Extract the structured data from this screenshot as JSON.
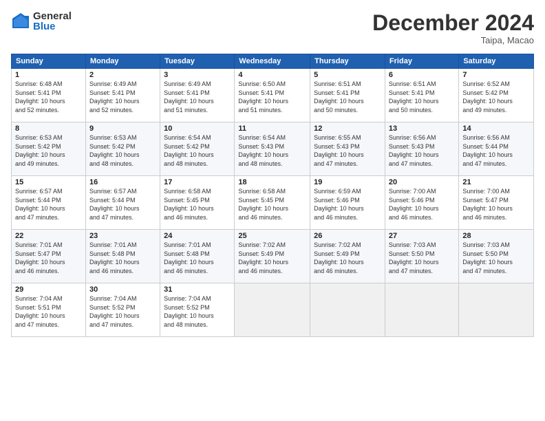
{
  "logo": {
    "general": "General",
    "blue": "Blue"
  },
  "header": {
    "title": "December 2024",
    "location": "Taipa, Macao"
  },
  "weekdays": [
    "Sunday",
    "Monday",
    "Tuesday",
    "Wednesday",
    "Thursday",
    "Friday",
    "Saturday"
  ],
  "weeks": [
    [
      {
        "day": "1",
        "info": "Sunrise: 6:48 AM\nSunset: 5:41 PM\nDaylight: 10 hours\nand 52 minutes."
      },
      {
        "day": "2",
        "info": "Sunrise: 6:49 AM\nSunset: 5:41 PM\nDaylight: 10 hours\nand 52 minutes."
      },
      {
        "day": "3",
        "info": "Sunrise: 6:49 AM\nSunset: 5:41 PM\nDaylight: 10 hours\nand 51 minutes."
      },
      {
        "day": "4",
        "info": "Sunrise: 6:50 AM\nSunset: 5:41 PM\nDaylight: 10 hours\nand 51 minutes."
      },
      {
        "day": "5",
        "info": "Sunrise: 6:51 AM\nSunset: 5:41 PM\nDaylight: 10 hours\nand 50 minutes."
      },
      {
        "day": "6",
        "info": "Sunrise: 6:51 AM\nSunset: 5:41 PM\nDaylight: 10 hours\nand 50 minutes."
      },
      {
        "day": "7",
        "info": "Sunrise: 6:52 AM\nSunset: 5:42 PM\nDaylight: 10 hours\nand 49 minutes."
      }
    ],
    [
      {
        "day": "8",
        "info": "Sunrise: 6:53 AM\nSunset: 5:42 PM\nDaylight: 10 hours\nand 49 minutes."
      },
      {
        "day": "9",
        "info": "Sunrise: 6:53 AM\nSunset: 5:42 PM\nDaylight: 10 hours\nand 48 minutes."
      },
      {
        "day": "10",
        "info": "Sunrise: 6:54 AM\nSunset: 5:42 PM\nDaylight: 10 hours\nand 48 minutes."
      },
      {
        "day": "11",
        "info": "Sunrise: 6:54 AM\nSunset: 5:43 PM\nDaylight: 10 hours\nand 48 minutes."
      },
      {
        "day": "12",
        "info": "Sunrise: 6:55 AM\nSunset: 5:43 PM\nDaylight: 10 hours\nand 47 minutes."
      },
      {
        "day": "13",
        "info": "Sunrise: 6:56 AM\nSunset: 5:43 PM\nDaylight: 10 hours\nand 47 minutes."
      },
      {
        "day": "14",
        "info": "Sunrise: 6:56 AM\nSunset: 5:44 PM\nDaylight: 10 hours\nand 47 minutes."
      }
    ],
    [
      {
        "day": "15",
        "info": "Sunrise: 6:57 AM\nSunset: 5:44 PM\nDaylight: 10 hours\nand 47 minutes."
      },
      {
        "day": "16",
        "info": "Sunrise: 6:57 AM\nSunset: 5:44 PM\nDaylight: 10 hours\nand 47 minutes."
      },
      {
        "day": "17",
        "info": "Sunrise: 6:58 AM\nSunset: 5:45 PM\nDaylight: 10 hours\nand 46 minutes."
      },
      {
        "day": "18",
        "info": "Sunrise: 6:58 AM\nSunset: 5:45 PM\nDaylight: 10 hours\nand 46 minutes."
      },
      {
        "day": "19",
        "info": "Sunrise: 6:59 AM\nSunset: 5:46 PM\nDaylight: 10 hours\nand 46 minutes."
      },
      {
        "day": "20",
        "info": "Sunrise: 7:00 AM\nSunset: 5:46 PM\nDaylight: 10 hours\nand 46 minutes."
      },
      {
        "day": "21",
        "info": "Sunrise: 7:00 AM\nSunset: 5:47 PM\nDaylight: 10 hours\nand 46 minutes."
      }
    ],
    [
      {
        "day": "22",
        "info": "Sunrise: 7:01 AM\nSunset: 5:47 PM\nDaylight: 10 hours\nand 46 minutes."
      },
      {
        "day": "23",
        "info": "Sunrise: 7:01 AM\nSunset: 5:48 PM\nDaylight: 10 hours\nand 46 minutes."
      },
      {
        "day": "24",
        "info": "Sunrise: 7:01 AM\nSunset: 5:48 PM\nDaylight: 10 hours\nand 46 minutes."
      },
      {
        "day": "25",
        "info": "Sunrise: 7:02 AM\nSunset: 5:49 PM\nDaylight: 10 hours\nand 46 minutes."
      },
      {
        "day": "26",
        "info": "Sunrise: 7:02 AM\nSunset: 5:49 PM\nDaylight: 10 hours\nand 46 minutes."
      },
      {
        "day": "27",
        "info": "Sunrise: 7:03 AM\nSunset: 5:50 PM\nDaylight: 10 hours\nand 47 minutes."
      },
      {
        "day": "28",
        "info": "Sunrise: 7:03 AM\nSunset: 5:50 PM\nDaylight: 10 hours\nand 47 minutes."
      }
    ],
    [
      {
        "day": "29",
        "info": "Sunrise: 7:04 AM\nSunset: 5:51 PM\nDaylight: 10 hours\nand 47 minutes."
      },
      {
        "day": "30",
        "info": "Sunrise: 7:04 AM\nSunset: 5:52 PM\nDaylight: 10 hours\nand 47 minutes."
      },
      {
        "day": "31",
        "info": "Sunrise: 7:04 AM\nSunset: 5:52 PM\nDaylight: 10 hours\nand 48 minutes."
      },
      {
        "day": "",
        "info": ""
      },
      {
        "day": "",
        "info": ""
      },
      {
        "day": "",
        "info": ""
      },
      {
        "day": "",
        "info": ""
      }
    ]
  ]
}
